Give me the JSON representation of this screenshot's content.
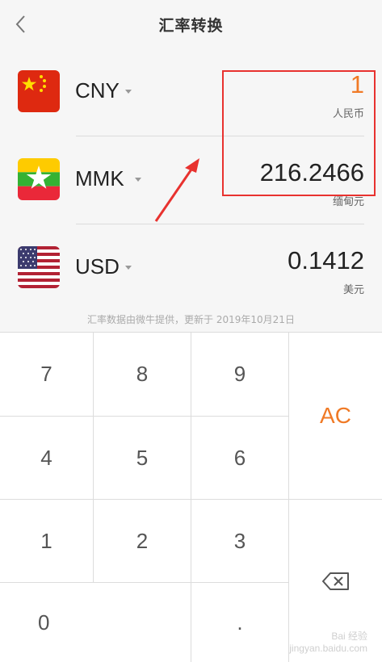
{
  "header": {
    "title": "汇率转换"
  },
  "currencies": [
    {
      "code": "CNY",
      "value": "1",
      "name": "人民币",
      "value_color": "#f07a26"
    },
    {
      "code": "MMK",
      "value": "216.2466",
      "name": "缅甸元",
      "value_color": "#222222"
    },
    {
      "code": "USD",
      "value": "0.1412",
      "name": "美元",
      "value_color": "#222222"
    }
  ],
  "footer_note": "汇率数据由微牛提供，更新于 2019年10月21日",
  "keypad": {
    "keys": [
      "7",
      "8",
      "9",
      "4",
      "5",
      "6",
      "1",
      "2",
      "3",
      "0",
      "."
    ],
    "clear_label": "AC",
    "clear_color": "#f07a26",
    "backspace_icon": "backspace-icon"
  },
  "watermark": {
    "line1": "Bai 经验",
    "line2": "jingyan.baidu.com"
  },
  "annotation_color": "#e8322f"
}
